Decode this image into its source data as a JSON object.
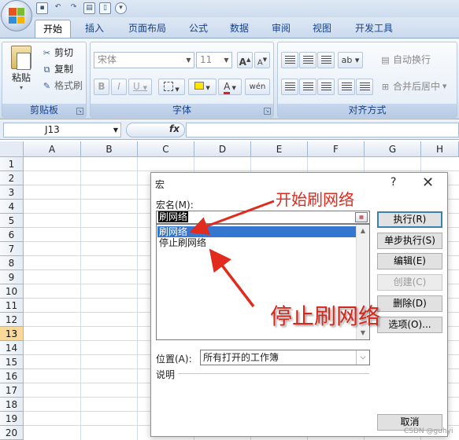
{
  "quick_access": {
    "icons": [
      "save-icon",
      "undo-icon",
      "redo-icon",
      "print-preview-icon",
      "new-icon",
      "customize-icon"
    ]
  },
  "tabs": [
    {
      "label": "开始",
      "active": true
    },
    {
      "label": "插入"
    },
    {
      "label": "页面布局"
    },
    {
      "label": "公式"
    },
    {
      "label": "数据"
    },
    {
      "label": "审阅"
    },
    {
      "label": "视图"
    },
    {
      "label": "开发工具"
    }
  ],
  "ribbon": {
    "clipboard": {
      "paste": "粘贴",
      "cut": "剪切",
      "copy": "复制",
      "format_painter": "格式刷",
      "group_label": "剪贴板"
    },
    "font": {
      "font_name": "宋体",
      "font_size": "11",
      "bold": "B",
      "italic": "I",
      "underline": "U",
      "grow": "A",
      "shrink": "A",
      "font_color": "A",
      "phonetic": "wén",
      "group_label": "字体"
    },
    "alignment": {
      "wrap_text": "自动换行",
      "merge_center": "合并后居中",
      "group_label": "对齐方式"
    }
  },
  "formula_bar": {
    "name_box": "J13",
    "fx": "fx",
    "formula": ""
  },
  "grid": {
    "columns": [
      "A",
      "B",
      "C",
      "D",
      "E",
      "F",
      "G",
      "H"
    ],
    "rows": [
      "1",
      "2",
      "3",
      "4",
      "5",
      "6",
      "7",
      "8",
      "9",
      "10",
      "11",
      "12",
      "13",
      "14",
      "15",
      "16",
      "17",
      "18",
      "19",
      "20"
    ],
    "active_row": "13"
  },
  "macro_dialog": {
    "title": "宏",
    "help": "?",
    "macro_name_label": "宏名(M):",
    "macro_name_value": "刷网络",
    "macros": [
      {
        "name": "刷网络",
        "selected": true
      },
      {
        "name": "停止刷网络",
        "selected": false
      }
    ],
    "buttons": {
      "run": "执行(R)",
      "step_into": "单步执行(S)",
      "edit": "编辑(E)",
      "create": "创建(C)",
      "delete": "删除(D)",
      "options": "选项(O)...",
      "cancel": "取消"
    },
    "location_label": "位置(A):",
    "location_value": "所有打开的工作簿",
    "description_label": "说明"
  },
  "annotations": {
    "start": "开始刷网络",
    "stop": "停止刷网络",
    "color": "#e02b1e"
  },
  "watermark": "CSDN @guhyi"
}
